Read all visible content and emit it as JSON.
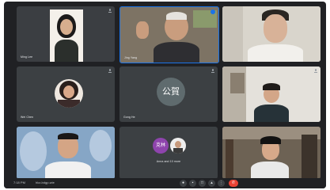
{
  "tiles": [
    {
      "name": "Ming Lee",
      "initials": "",
      "muted": true
    },
    {
      "name": "Jing Yang",
      "initials": "",
      "muted": false
    },
    {
      "name": "",
      "initials": "",
      "muted": false
    },
    {
      "name": "Wei Chen",
      "initials": "",
      "muted": true
    },
    {
      "name": "Gong He",
      "initials": "公賀",
      "muted": true
    },
    {
      "name": "",
      "initials": "",
      "muted": false
    },
    {
      "name": "",
      "initials": "",
      "muted": false
    },
    {
      "name": "Anna and 10 more",
      "initials": "克林",
      "muted": false
    },
    {
      "name": "",
      "initials": "",
      "muted": false
    }
  ],
  "bottom_bar": {
    "time": "7:18 PM",
    "meeting": "hkz-bdgp-wie",
    "controls": [
      "mic",
      "camera",
      "captions",
      "present",
      "more",
      "leave"
    ]
  },
  "colors": {
    "accent": "#1a73e8",
    "leave": "#ea4335"
  },
  "icons": {
    "mic": "microphone-icon",
    "leave": "end-call-icon"
  }
}
